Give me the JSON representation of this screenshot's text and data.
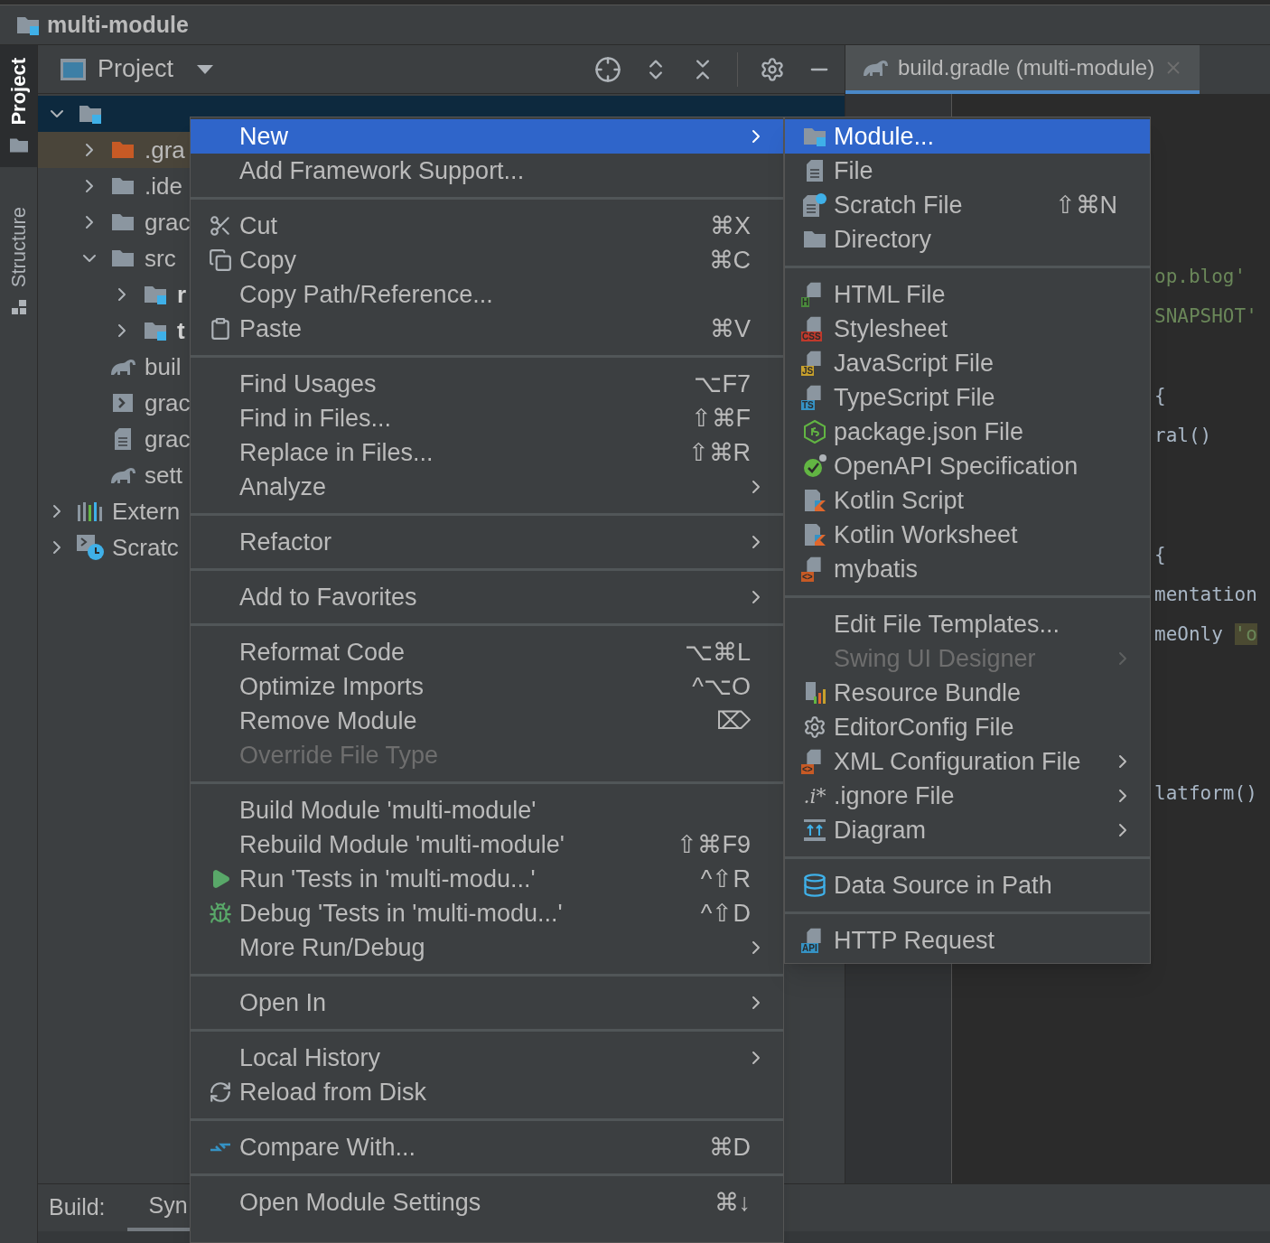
{
  "window": {
    "title": "multi-module"
  },
  "tool_stripe": [
    {
      "label": "Project",
      "kind": "folder",
      "selected": true
    },
    {
      "label": "Structure",
      "kind": "structure",
      "selected": false
    }
  ],
  "project_panel": {
    "title": "Project"
  },
  "tree": [
    {
      "kind": "module",
      "expanded": true,
      "selected": true,
      "children": [
        {
          "label": ".gra",
          "kind": "folder-orange",
          "expanded": false,
          "selected": false,
          "excluded": true
        },
        {
          "label": ".ide",
          "kind": "folder",
          "expanded": false,
          "selected": false
        },
        {
          "label": "grac",
          "kind": "folder",
          "expanded": false,
          "selected": false
        },
        {
          "label": "src",
          "kind": "folder",
          "expanded": true,
          "selected": false,
          "children": [
            {
              "label": "r",
              "kind": "module",
              "expanded": false,
              "selected": false,
              "bold": true
            },
            {
              "label": "t",
              "kind": "module",
              "expanded": false,
              "selected": false,
              "bold": true
            }
          ]
        },
        {
          "label": "buil",
          "kind": "gradle",
          "selected": false
        },
        {
          "label": "grac",
          "kind": "terminal",
          "selected": false
        },
        {
          "label": "grac",
          "kind": "text",
          "selected": false
        },
        {
          "label": "sett",
          "kind": "gradle",
          "selected": false
        }
      ]
    },
    {
      "label": "Extern",
      "kind": "library",
      "expanded": false,
      "selected": false
    },
    {
      "label": "Scratc",
      "kind": "scratch",
      "expanded": false,
      "selected": false
    }
  ],
  "editor_tabs": [
    {
      "label": "build.gradle (multi-module)",
      "selected": true
    }
  ],
  "code_lines": [
    {
      "kind": "blank"
    },
    {
      "kind": "blank"
    },
    {
      "kind": "blank"
    },
    {
      "kind": "blank"
    },
    {
      "kind": "code",
      "segments": [
        {
          "text": "op.blog'",
          "kind": "string"
        }
      ]
    },
    {
      "kind": "code",
      "segments": [
        {
          "text": "SNAPSHOT'",
          "kind": "string"
        }
      ]
    },
    {
      "kind": "blank"
    },
    {
      "kind": "code",
      "segments": [
        {
          "text": "{",
          "kind": "plain"
        }
      ]
    },
    {
      "kind": "code",
      "segments": [
        {
          "text": "ral()",
          "kind": "plain"
        }
      ]
    },
    {
      "kind": "blank"
    },
    {
      "kind": "blank"
    },
    {
      "kind": "code",
      "segments": [
        {
          "text": "{",
          "kind": "plain"
        }
      ]
    },
    {
      "kind": "code",
      "segments": [
        {
          "text": "mentation",
          "kind": "plain"
        }
      ]
    },
    {
      "kind": "code",
      "segments": [
        {
          "text": "meOnly ",
          "kind": "plain"
        },
        {
          "text": "'o",
          "kind": "highlight"
        }
      ]
    },
    {
      "kind": "blank"
    },
    {
      "kind": "blank"
    },
    {
      "kind": "blank"
    },
    {
      "kind": "code",
      "segments": [
        {
          "text": "latform()",
          "kind": "plain"
        }
      ]
    }
  ],
  "build_panel": {
    "label": "Build:",
    "tabs": [
      {
        "label": "Syn",
        "selected": true
      }
    ]
  },
  "context_menu": {
    "groups": [
      [
        {
          "label": "New",
          "submenu": true,
          "selected": true
        },
        {
          "label": "Add Framework Support...",
          "selected": false
        }
      ],
      [
        {
          "label": "Cut",
          "shortcut": "⌘X",
          "kind": "cut",
          "selected": false
        },
        {
          "label": "Copy",
          "shortcut": "⌘C",
          "kind": "copy",
          "selected": false
        },
        {
          "label": "Copy Path/Reference...",
          "selected": false
        },
        {
          "label": "Paste",
          "shortcut": "⌘V",
          "kind": "paste",
          "selected": false
        }
      ],
      [
        {
          "label": "Find Usages",
          "shortcut": "⌥F7",
          "selected": false
        },
        {
          "label": "Find in Files...",
          "shortcut": "⇧⌘F",
          "selected": false
        },
        {
          "label": "Replace in Files...",
          "shortcut": "⇧⌘R",
          "selected": false
        },
        {
          "label": "Analyze",
          "submenu": true,
          "selected": false
        }
      ],
      [
        {
          "label": "Refactor",
          "submenu": true,
          "selected": false
        }
      ],
      [
        {
          "label": "Add to Favorites",
          "submenu": true,
          "selected": false
        }
      ],
      [
        {
          "label": "Reformat Code",
          "shortcut": "⌥⌘L",
          "selected": false
        },
        {
          "label": "Optimize Imports",
          "shortcut": "^⌥O",
          "selected": false
        },
        {
          "label": "Remove Module",
          "shortcut": "⌦",
          "selected": false
        },
        {
          "label": "Override File Type",
          "disabled": true,
          "selected": false
        }
      ],
      [
        {
          "label": "Build Module 'multi-module'",
          "selected": false
        },
        {
          "label": "Rebuild Module 'multi-module'",
          "shortcut": "⇧⌘F9",
          "selected": false
        },
        {
          "label": "Run 'Tests in 'multi-modu...'",
          "shortcut": "^⇧R",
          "kind": "run",
          "selected": false
        },
        {
          "label": "Debug 'Tests in 'multi-modu...'",
          "shortcut": "^⇧D",
          "kind": "debug",
          "selected": false
        },
        {
          "label": "More Run/Debug",
          "submenu": true,
          "selected": false
        }
      ],
      [
        {
          "label": "Open In",
          "submenu": true,
          "selected": false
        }
      ],
      [
        {
          "label": "Local History",
          "submenu": true,
          "selected": false
        },
        {
          "label": "Reload from Disk",
          "kind": "reload",
          "selected": false
        }
      ],
      [
        {
          "label": "Compare With...",
          "shortcut": "⌘D",
          "kind": "compare",
          "selected": false
        }
      ],
      [
        {
          "label": "Open Module Settings",
          "shortcut": "⌘↓",
          "selected": false
        }
      ]
    ]
  },
  "new_submenu": {
    "groups": [
      [
        {
          "label": "Module...",
          "kind": "module",
          "selected": true
        },
        {
          "label": "File",
          "kind": "file",
          "selected": false
        },
        {
          "label": "Scratch File",
          "kind": "scratch-file",
          "shortcut": "⇧⌘N",
          "selected": false
        },
        {
          "label": "Directory",
          "kind": "folder",
          "selected": false
        }
      ],
      [
        {
          "label": "HTML File",
          "kind": "html",
          "badge": "H",
          "selected": false
        },
        {
          "label": "Stylesheet",
          "kind": "css",
          "badge": "CSS",
          "selected": false
        },
        {
          "label": "JavaScript File",
          "kind": "js",
          "badge": "JS",
          "selected": false
        },
        {
          "label": "TypeScript File",
          "kind": "ts",
          "badge": "TS",
          "selected": false
        },
        {
          "label": "package.json File",
          "kind": "node",
          "selected": false
        },
        {
          "label": "OpenAPI Specification",
          "kind": "openapi",
          "selected": false
        },
        {
          "label": "Kotlin Script",
          "kind": "kotlin",
          "selected": false
        },
        {
          "label": "Kotlin Worksheet",
          "kind": "kotlin",
          "selected": false
        },
        {
          "label": "mybatis",
          "kind": "xml",
          "badge": "<>",
          "selected": false
        }
      ],
      [
        {
          "label": "Edit File Templates...",
          "selected": false
        },
        {
          "label": "Swing UI Designer",
          "submenu": true,
          "disabled": true,
          "selected": false
        },
        {
          "label": "Resource Bundle",
          "kind": "bundle",
          "selected": false
        },
        {
          "label": "EditorConfig File",
          "kind": "gear",
          "selected": false
        },
        {
          "label": "XML Configuration File",
          "kind": "xml",
          "badge": "<>",
          "submenu": true,
          "selected": false
        },
        {
          "label": ".ignore File",
          "glyph": ".i*",
          "submenu": true,
          "selected": false
        },
        {
          "label": "Diagram",
          "kind": "diagram",
          "submenu": true,
          "selected": false
        }
      ],
      [
        {
          "label": "Data Source in Path",
          "kind": "database",
          "selected": false
        }
      ],
      [
        {
          "label": "HTTP Request",
          "kind": "ts",
          "badge": "API",
          "selected": false
        }
      ]
    ]
  }
}
